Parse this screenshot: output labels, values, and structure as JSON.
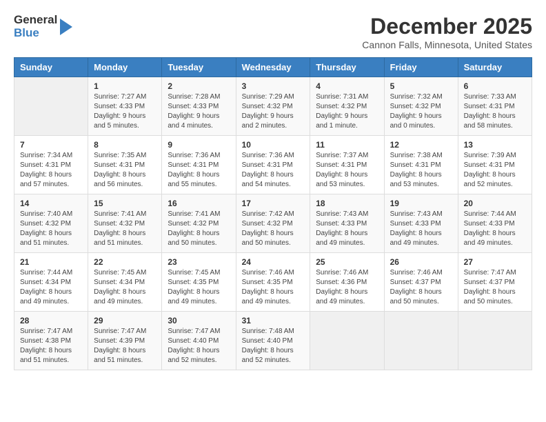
{
  "logo": {
    "general": "General",
    "blue": "Blue"
  },
  "title": "December 2025",
  "subtitle": "Cannon Falls, Minnesota, United States",
  "days_header": [
    "Sunday",
    "Monday",
    "Tuesday",
    "Wednesday",
    "Thursday",
    "Friday",
    "Saturday"
  ],
  "weeks": [
    [
      {
        "day": "",
        "sunrise": "",
        "sunset": "",
        "daylight": "",
        "empty": true
      },
      {
        "day": "1",
        "sunrise": "Sunrise: 7:27 AM",
        "sunset": "Sunset: 4:33 PM",
        "daylight": "Daylight: 9 hours and 5 minutes."
      },
      {
        "day": "2",
        "sunrise": "Sunrise: 7:28 AM",
        "sunset": "Sunset: 4:33 PM",
        "daylight": "Daylight: 9 hours and 4 minutes."
      },
      {
        "day": "3",
        "sunrise": "Sunrise: 7:29 AM",
        "sunset": "Sunset: 4:32 PM",
        "daylight": "Daylight: 9 hours and 2 minutes."
      },
      {
        "day": "4",
        "sunrise": "Sunrise: 7:31 AM",
        "sunset": "Sunset: 4:32 PM",
        "daylight": "Daylight: 9 hours and 1 minute."
      },
      {
        "day": "5",
        "sunrise": "Sunrise: 7:32 AM",
        "sunset": "Sunset: 4:32 PM",
        "daylight": "Daylight: 9 hours and 0 minutes."
      },
      {
        "day": "6",
        "sunrise": "Sunrise: 7:33 AM",
        "sunset": "Sunset: 4:31 PM",
        "daylight": "Daylight: 8 hours and 58 minutes."
      }
    ],
    [
      {
        "day": "7",
        "sunrise": "Sunrise: 7:34 AM",
        "sunset": "Sunset: 4:31 PM",
        "daylight": "Daylight: 8 hours and 57 minutes."
      },
      {
        "day": "8",
        "sunrise": "Sunrise: 7:35 AM",
        "sunset": "Sunset: 4:31 PM",
        "daylight": "Daylight: 8 hours and 56 minutes."
      },
      {
        "day": "9",
        "sunrise": "Sunrise: 7:36 AM",
        "sunset": "Sunset: 4:31 PM",
        "daylight": "Daylight: 8 hours and 55 minutes."
      },
      {
        "day": "10",
        "sunrise": "Sunrise: 7:36 AM",
        "sunset": "Sunset: 4:31 PM",
        "daylight": "Daylight: 8 hours and 54 minutes."
      },
      {
        "day": "11",
        "sunrise": "Sunrise: 7:37 AM",
        "sunset": "Sunset: 4:31 PM",
        "daylight": "Daylight: 8 hours and 53 minutes."
      },
      {
        "day": "12",
        "sunrise": "Sunrise: 7:38 AM",
        "sunset": "Sunset: 4:31 PM",
        "daylight": "Daylight: 8 hours and 53 minutes."
      },
      {
        "day": "13",
        "sunrise": "Sunrise: 7:39 AM",
        "sunset": "Sunset: 4:31 PM",
        "daylight": "Daylight: 8 hours and 52 minutes."
      }
    ],
    [
      {
        "day": "14",
        "sunrise": "Sunrise: 7:40 AM",
        "sunset": "Sunset: 4:32 PM",
        "daylight": "Daylight: 8 hours and 51 minutes."
      },
      {
        "day": "15",
        "sunrise": "Sunrise: 7:41 AM",
        "sunset": "Sunset: 4:32 PM",
        "daylight": "Daylight: 8 hours and 51 minutes."
      },
      {
        "day": "16",
        "sunrise": "Sunrise: 7:41 AM",
        "sunset": "Sunset: 4:32 PM",
        "daylight": "Daylight: 8 hours and 50 minutes."
      },
      {
        "day": "17",
        "sunrise": "Sunrise: 7:42 AM",
        "sunset": "Sunset: 4:32 PM",
        "daylight": "Daylight: 8 hours and 50 minutes."
      },
      {
        "day": "18",
        "sunrise": "Sunrise: 7:43 AM",
        "sunset": "Sunset: 4:33 PM",
        "daylight": "Daylight: 8 hours and 49 minutes."
      },
      {
        "day": "19",
        "sunrise": "Sunrise: 7:43 AM",
        "sunset": "Sunset: 4:33 PM",
        "daylight": "Daylight: 8 hours and 49 minutes."
      },
      {
        "day": "20",
        "sunrise": "Sunrise: 7:44 AM",
        "sunset": "Sunset: 4:33 PM",
        "daylight": "Daylight: 8 hours and 49 minutes."
      }
    ],
    [
      {
        "day": "21",
        "sunrise": "Sunrise: 7:44 AM",
        "sunset": "Sunset: 4:34 PM",
        "daylight": "Daylight: 8 hours and 49 minutes."
      },
      {
        "day": "22",
        "sunrise": "Sunrise: 7:45 AM",
        "sunset": "Sunset: 4:34 PM",
        "daylight": "Daylight: 8 hours and 49 minutes."
      },
      {
        "day": "23",
        "sunrise": "Sunrise: 7:45 AM",
        "sunset": "Sunset: 4:35 PM",
        "daylight": "Daylight: 8 hours and 49 minutes."
      },
      {
        "day": "24",
        "sunrise": "Sunrise: 7:46 AM",
        "sunset": "Sunset: 4:35 PM",
        "daylight": "Daylight: 8 hours and 49 minutes."
      },
      {
        "day": "25",
        "sunrise": "Sunrise: 7:46 AM",
        "sunset": "Sunset: 4:36 PM",
        "daylight": "Daylight: 8 hours and 49 minutes."
      },
      {
        "day": "26",
        "sunrise": "Sunrise: 7:46 AM",
        "sunset": "Sunset: 4:37 PM",
        "daylight": "Daylight: 8 hours and 50 minutes."
      },
      {
        "day": "27",
        "sunrise": "Sunrise: 7:47 AM",
        "sunset": "Sunset: 4:37 PM",
        "daylight": "Daylight: 8 hours and 50 minutes."
      }
    ],
    [
      {
        "day": "28",
        "sunrise": "Sunrise: 7:47 AM",
        "sunset": "Sunset: 4:38 PM",
        "daylight": "Daylight: 8 hours and 51 minutes."
      },
      {
        "day": "29",
        "sunrise": "Sunrise: 7:47 AM",
        "sunset": "Sunset: 4:39 PM",
        "daylight": "Daylight: 8 hours and 51 minutes."
      },
      {
        "day": "30",
        "sunrise": "Sunrise: 7:47 AM",
        "sunset": "Sunset: 4:40 PM",
        "daylight": "Daylight: 8 hours and 52 minutes."
      },
      {
        "day": "31",
        "sunrise": "Sunrise: 7:48 AM",
        "sunset": "Sunset: 4:40 PM",
        "daylight": "Daylight: 8 hours and 52 minutes."
      },
      {
        "day": "",
        "sunrise": "",
        "sunset": "",
        "daylight": "",
        "empty": true
      },
      {
        "day": "",
        "sunrise": "",
        "sunset": "",
        "daylight": "",
        "empty": true
      },
      {
        "day": "",
        "sunrise": "",
        "sunset": "",
        "daylight": "",
        "empty": true
      }
    ]
  ]
}
